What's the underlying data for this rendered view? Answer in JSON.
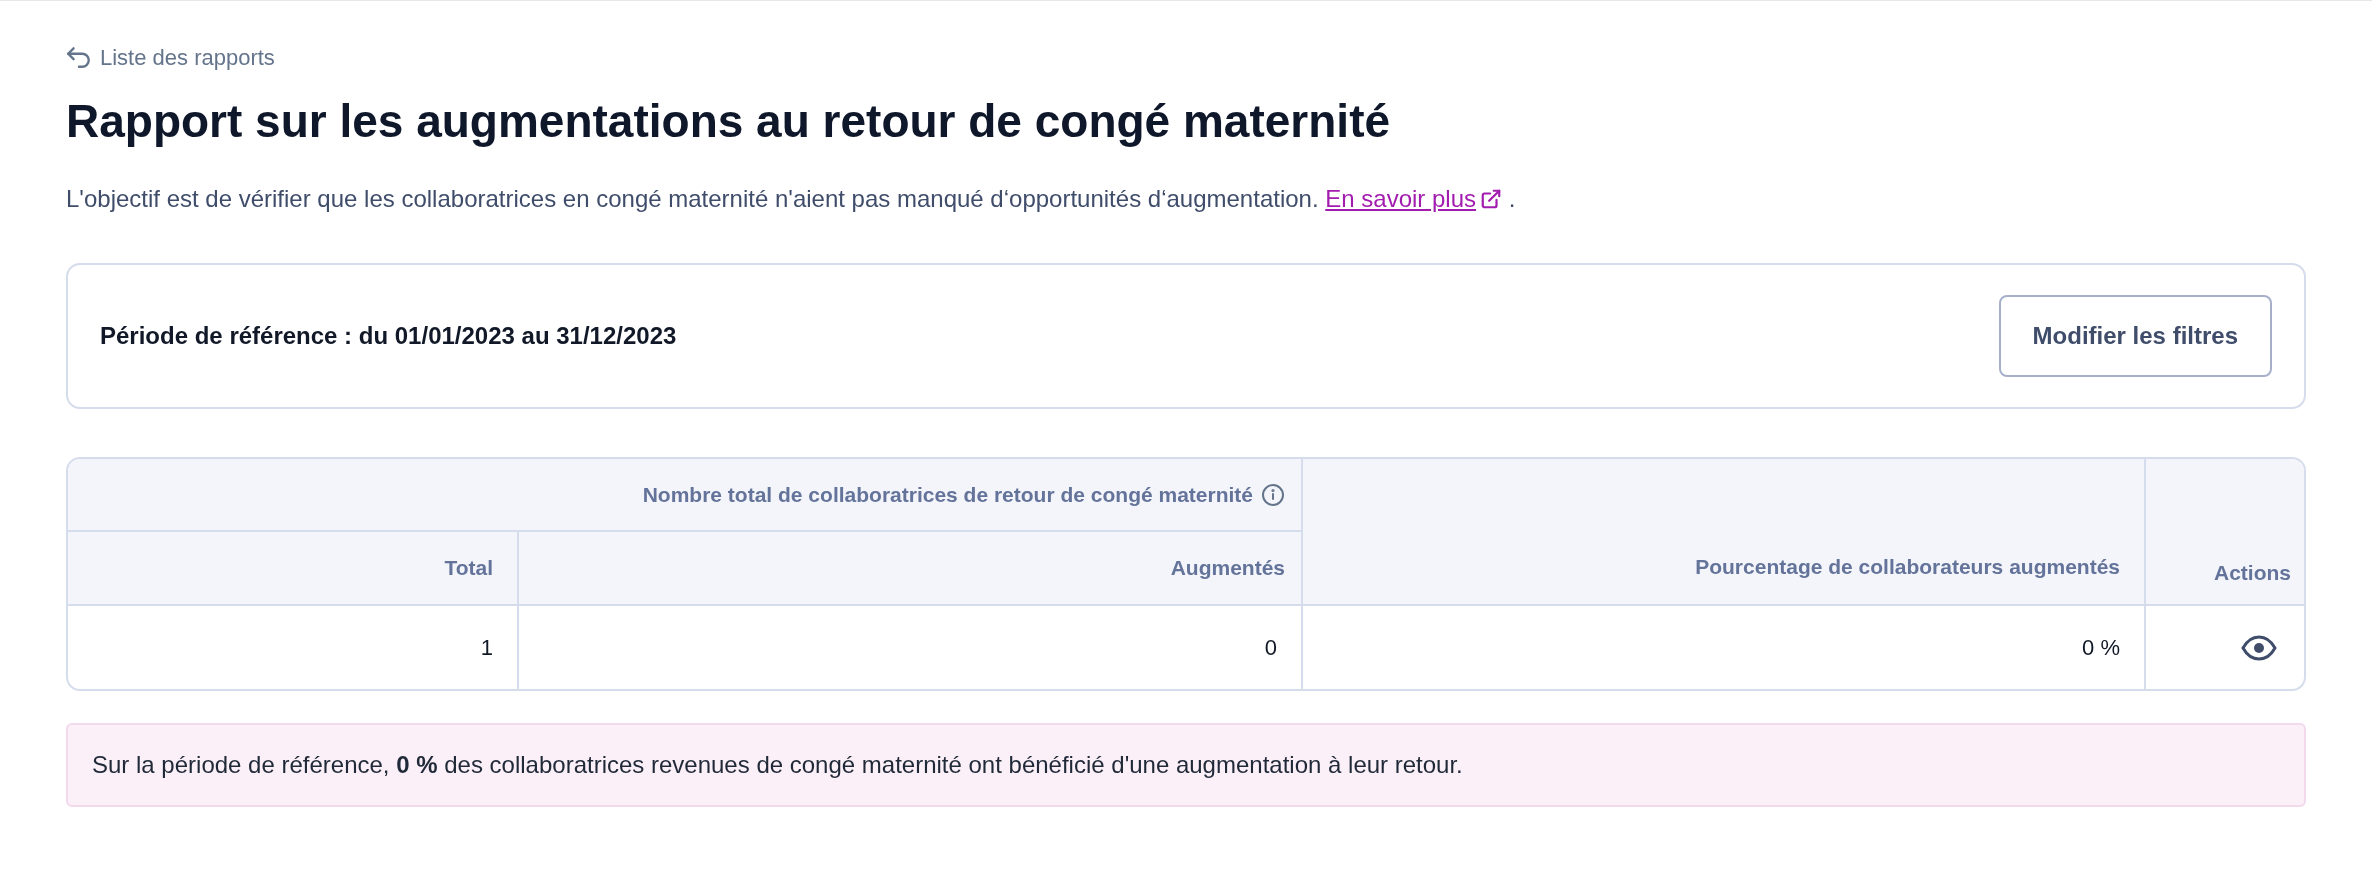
{
  "breadcrumb": {
    "label": "Liste des rapports"
  },
  "title": "Rapport sur les augmentations au retour de congé maternité",
  "description": {
    "text": "L'objectif est de vérifier que les collaboratrices en congé maternité n'aient pas manqué d‘opportunités d‘augmentation.",
    "link": "En savoir plus",
    "suffix": "."
  },
  "filters": {
    "period": "Période de référence : du 01/01/2023 au 31/12/2023",
    "button": "Modifier les filtres"
  },
  "table": {
    "group_header": "Nombre total de collaboratrices de retour de congé maternité",
    "columns": [
      "Total",
      "Augmentés",
      "Pourcentage de collaborateurs augmentés",
      "Actions"
    ],
    "rows": [
      {
        "cells": [
          "1",
          "0",
          "0 %"
        ]
      }
    ]
  },
  "summary": "Sur la période de référence, **0 %** des collaboratrices revenues de congé maternité ont bénéficié d'une augmentation à leur retour."
}
